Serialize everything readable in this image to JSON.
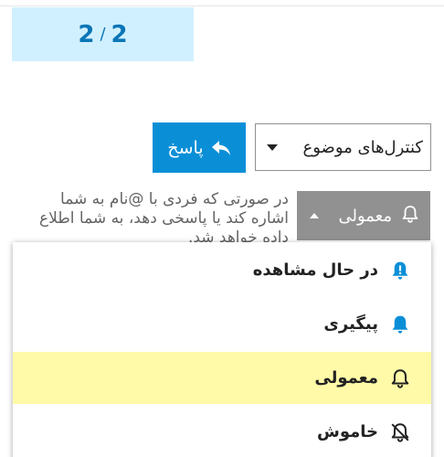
{
  "progress": {
    "current": "2",
    "separator": "/",
    "total": "2"
  },
  "reply_button": {
    "label": "پاسخ"
  },
  "topic_controls": {
    "label": "کنترل‌های موضوع"
  },
  "notifications": {
    "button_label": "معمولی",
    "description": "در صورتی که فردی با @نام به شما اشاره کند یا پاسخی دهد، به شما اطلاع داده خواهد شد.",
    "options": [
      {
        "label": "در حال مشاهده",
        "icon": "bell-exclamation-icon",
        "color": "#0a8fd7",
        "selected": false
      },
      {
        "label": "پیگیری",
        "icon": "bell-icon",
        "color": "#0a8fd7",
        "selected": false
      },
      {
        "label": "معمولی",
        "icon": "bell-outline-icon",
        "color": "#222222",
        "selected": true
      },
      {
        "label": "خاموش",
        "icon": "bell-slash-icon",
        "color": "#222222",
        "selected": false
      }
    ]
  },
  "colors": {
    "primary": "#0a8fd7",
    "progress_bg": "#d1f0ff",
    "progress_text": "#0a76b7",
    "selected_bg": "#fffaa8",
    "notif_button_bg": "#919191"
  }
}
